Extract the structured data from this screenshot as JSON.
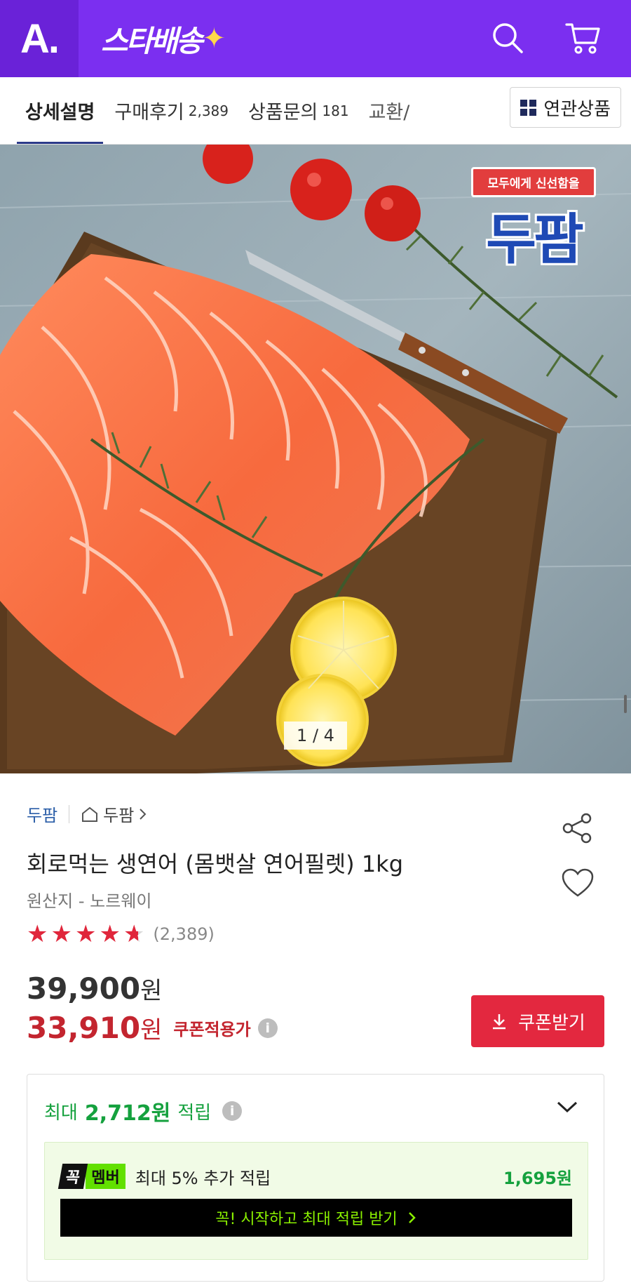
{
  "header": {
    "logo": "A.",
    "star_delivery": "스타배송",
    "search_icon": "search-icon",
    "cart_icon": "cart-icon"
  },
  "tabs": [
    {
      "label": "상세설명",
      "count": "",
      "active": true
    },
    {
      "label": "구매후기",
      "count": "2,389",
      "active": false
    },
    {
      "label": "상품문의",
      "count": "181",
      "active": false
    },
    {
      "label": "교환/",
      "count": "",
      "active": false
    }
  ],
  "related_button": "연관상품",
  "gallery": {
    "counter": "1 / 4",
    "brand_slogan": "모두에게 신선함을",
    "brand_name": "두팜"
  },
  "product": {
    "brand": "두팜",
    "store": "두팜",
    "title": "회로먹는 생연어 (몸뱃살 연어필렛) 1kg",
    "origin": "원산지 - 노르웨이",
    "rating": 4.7,
    "review_count": "(2,389)",
    "original_price": "39,900",
    "sale_price": "33,910",
    "won": "원",
    "coupon_note": "쿠폰적용가",
    "coupon_button": "쿠폰받기"
  },
  "reward": {
    "prefix": "최대",
    "amount": "2,712원",
    "suffix": "적립",
    "member_badge_1": "꼭",
    "member_badge_2": "멤버",
    "member_text": "최대 5% 추가 적립",
    "member_bonus": "1,695원",
    "start_button": "꼭! 시작하고 최대 적립 받기"
  },
  "colors": {
    "brand_purple": "#7b2ff0",
    "sale_red": "#c3252f",
    "reward_green": "#15a13e",
    "member_green": "#62e000"
  }
}
